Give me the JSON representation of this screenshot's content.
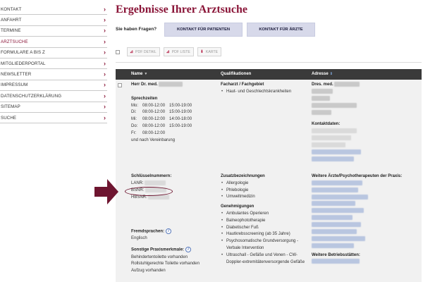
{
  "sidebar": {
    "items": [
      {
        "label": "KONTAKT"
      },
      {
        "label": "ANFAHRT"
      },
      {
        "label": "TERMINE"
      },
      {
        "label": "ARZTSUCHE"
      },
      {
        "label": "FORMULARE A BIS Z"
      },
      {
        "label": "MITGLIEDERPORTAL"
      },
      {
        "label": "NEWSLETTER"
      },
      {
        "label": "IMPRESSUM"
      },
      {
        "label": "DATENSCHUTZERKLÄRUNG"
      },
      {
        "label": "SITEMAP"
      },
      {
        "label": "SUCHE"
      }
    ],
    "active_index": 3
  },
  "header": {
    "title": "Ergebnisse Ihrer Arztsuche",
    "questions": "Sie haben Fragen?",
    "btn_patients": "KONTAKT FÜR PATIENTEN",
    "btn_aerzte": "KONTAKT FÜR ÄRZTE"
  },
  "toolbar": {
    "pdf_detail": "PDF DETAIL",
    "pdf_liste": "PDF LISTE",
    "karte": "KARTE"
  },
  "table": {
    "headers": {
      "name": "Name",
      "qualifikationen": "Qualifikationen",
      "adresse": "Adresse"
    },
    "row": {
      "doctor_name": "Herr Dr. med.",
      "sprechzeiten_label": "Sprechzeiten",
      "hours": [
        {
          "day": "Mo:",
          "t1": "08:00-12:00",
          "t2": "15:00-19:00"
        },
        {
          "day": "Di:",
          "t1": "08:00-12:00",
          "t2": "15:00-19:00"
        },
        {
          "day": "Mi:",
          "t1": "08:00-12:00",
          "t2": "14:00-18:00"
        },
        {
          "day": "Do:",
          "t1": "08:00-12:00",
          "t2": "15:00-19:00"
        },
        {
          "day": "Fr:",
          "t1": "08:00-12:00",
          "t2": ""
        }
      ],
      "vereinbarung": "und nach Vereinbarung",
      "schluessel_label": "Schlüsselnummern:",
      "lanr": "LANR:",
      "bsnr": "BSNR:",
      "hbsnr": "HBSNR:",
      "fremdsprachen_label": "Fremdsprachen:",
      "fremdsprachen_value": "Englisch",
      "praxismerkmale_label": "Sonstige Praxismerkmale:",
      "praxismerkmale": [
        "Behindertentoilette vorhanden",
        "Rollstuhlgerechte Toilette vorhanden",
        "Aufzug vorhanden"
      ],
      "facharzt_label": "Facharzt / Fachgebiet",
      "facharzt": [
        "Haut- und Geschlechtskrankheiten"
      ],
      "zusatz_label": "Zusatzbezeichnungen",
      "zusatz": [
        "Allergologie",
        "Phlebologie",
        "Umweltmedizin"
      ],
      "genehmigungen_label": "Genehmigungen",
      "genehmigungen": [
        "Ambulantes Operieren",
        "Balneophototherapie",
        "Diabetischer Fuß",
        "Hautkrebsscreening (ab 35 Jahre)",
        "Psychosomatische Grundversorgung - Verbale Intervention",
        "Ultraschall - Gefäße und Venen - CW-Doppler-extremitätenversorgende Gefäße"
      ],
      "adresse_name": "Dres. med.",
      "kontaktdaten_label": "Kontaktdaten:",
      "weitere_aerzte_label": "Weitere Ärzte/Psychotherapeuten der Praxis:",
      "weitere_betrieb_label": "Weitere Betriebsstätten:"
    }
  },
  "icons": {
    "chevron": "chevron-right-icon",
    "pdf": "pdf-icon",
    "map": "map-pin-icon",
    "info": "info-icon"
  },
  "colors": {
    "brand": "#8a1538",
    "header_bg": "#3a3a3a",
    "button_bg": "#d7d9ea",
    "table_bg": "#f1f1f1"
  }
}
